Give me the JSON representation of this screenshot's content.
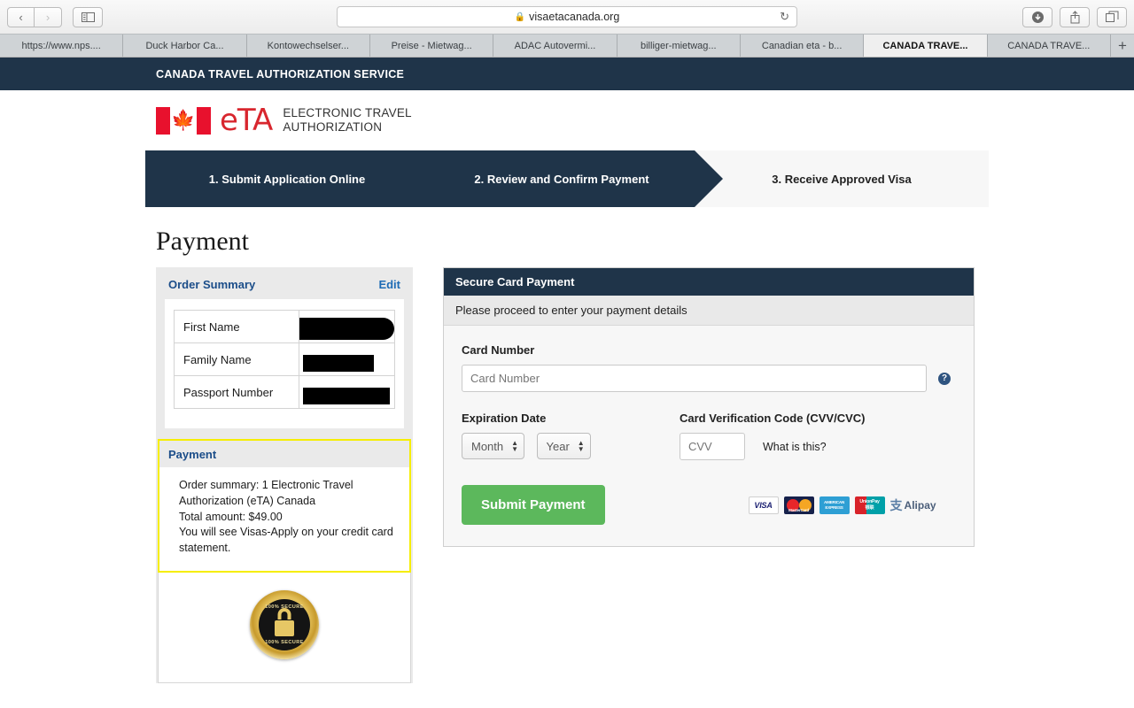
{
  "browser": {
    "url": "visaetacanada.org",
    "lock_icon": "lock-icon",
    "back_icon": "‹",
    "forward_icon": "›",
    "sidebar_icon": "sidebar-icon",
    "reload_icon": "↻",
    "downloads_icon": "⬇",
    "share_icon": "⇪",
    "tabs_overview_icon": "❐",
    "new_tab_label": "+",
    "tabs": [
      {
        "label": "https://www.nps....",
        "active": false
      },
      {
        "label": "Duck Harbor Ca...",
        "active": false
      },
      {
        "label": "Kontowechselser...",
        "active": false
      },
      {
        "label": "Preise - Mietwag...",
        "active": false
      },
      {
        "label": "ADAC Autovermi...",
        "active": false
      },
      {
        "label": "billiger-mietwag...",
        "active": false
      },
      {
        "label": "Canadian eta - b...",
        "active": false
      },
      {
        "label": "CANADA TRAVE...",
        "active": true
      },
      {
        "label": "CANADA TRAVE...",
        "active": false
      }
    ]
  },
  "site": {
    "topbar_title": "CANADA TRAVEL AUTHORIZATION SERVICE",
    "logo": {
      "flag_icon": "canada-flag-icon",
      "maple_leaf": "🍁",
      "eta_word": "eTA",
      "subtitle_line1": "ELECTRONIC TRAVEL",
      "subtitle_line2": "AUTHORIZATION"
    },
    "steps": [
      {
        "label": "1. Submit Application Online",
        "state": "done"
      },
      {
        "label": "2. Review and Confirm Payment",
        "state": "current"
      },
      {
        "label": "3. Receive Approved Visa",
        "state": "upcoming"
      }
    ],
    "page_title": "Payment"
  },
  "order_summary": {
    "heading": "Order Summary",
    "edit_label": "Edit",
    "rows": [
      {
        "label": "First Name",
        "value": "",
        "redacted": true
      },
      {
        "label": "Family Name",
        "value": "",
        "redacted": true
      },
      {
        "label": "Passport Number",
        "value": "",
        "redacted": true
      }
    ]
  },
  "payment_box": {
    "heading": "Payment",
    "line1": "Order summary: 1 Electronic Travel",
    "line2": "Authorization (eTA) Canada",
    "line3": "Total amount: $49.00",
    "line4": "You will see Visas-Apply on your credit card",
    "line5": "statement.",
    "total_amount": "$49.00",
    "quantity": "1",
    "product": "Electronic Travel Authorization (eTA) Canada",
    "descriptor": "Visas-Apply"
  },
  "seal": {
    "icon": "secure-seal-icon",
    "top_text": "100% SECURE",
    "bottom_text": "100% SECURE",
    "lock_icon": "lock-icon"
  },
  "card_panel": {
    "header": "Secure Card Payment",
    "subheader": "Please proceed to enter your payment details",
    "card_number": {
      "label": "Card Number",
      "placeholder": "Card Number",
      "value": "",
      "help_icon": "help-icon",
      "help_glyph": "?"
    },
    "expiration": {
      "label": "Expiration Date",
      "month_value": "Month",
      "year_value": "Year"
    },
    "cvv": {
      "label": "Card Verification Code (CVV/CVC)",
      "placeholder": "CVV",
      "value": "",
      "help_link": "What is this?"
    },
    "submit_label": "Submit Payment",
    "card_logos": [
      {
        "name": "visa-logo",
        "label": "VISA"
      },
      {
        "name": "mastercard-logo",
        "label": "MasterCard"
      },
      {
        "name": "amex-logo",
        "label_line1": "AMERICAN",
        "label_line2": "EXPRESS"
      },
      {
        "name": "unionpay-logo",
        "label_line1": "UnionPay",
        "label_line2": "银联"
      },
      {
        "name": "alipay-logo",
        "label": "Alipay",
        "glyph": "支"
      }
    ]
  },
  "colors": {
    "brand_navy": "#1f3449",
    "brand_red": "#d8262e",
    "link_blue": "#1f6cb5",
    "heading_blue": "#1b4d89",
    "submit_green": "#5cb85c",
    "highlight_yellow": "#f6ee00"
  }
}
